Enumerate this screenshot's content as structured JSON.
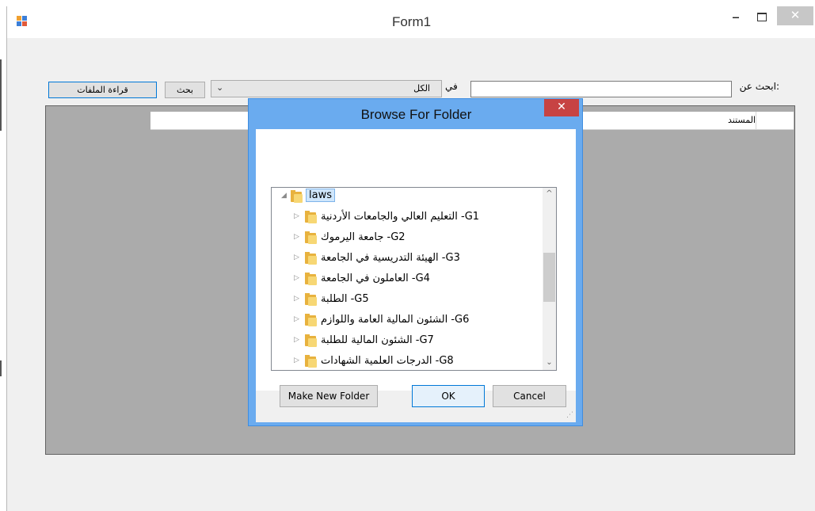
{
  "form": {
    "title": "Form1",
    "minimize": "–",
    "close": "✕"
  },
  "search": {
    "label": "ابحث عن:",
    "value": "",
    "in_label": "في",
    "scope_value": "الكل",
    "scope_arrow": "⌄",
    "search_button": "بحث",
    "read_files_button": "قراءة الملفات"
  },
  "grid": {
    "header_document": "المستند"
  },
  "dialog": {
    "title": "Browse For Folder",
    "close": "✕",
    "root": {
      "label": "laws",
      "expander": "◢"
    },
    "items": [
      {
        "label": "التعليم العالي والجامعات الأردنية -G1",
        "expander": "▷"
      },
      {
        "label": "جامعة اليرموك -G2",
        "expander": "▷"
      },
      {
        "label": "الهيئة التدريسية في الجامعة -G3",
        "expander": "▷"
      },
      {
        "label": "العاملون في الجامعة -G4",
        "expander": "▷"
      },
      {
        "label": "الطلبة -G5",
        "expander": "▷"
      },
      {
        "label": "الشئون المالية العامة واللوازم -G6",
        "expander": "▷"
      },
      {
        "label": "الشئون المالية للطلبة -G7",
        "expander": "▷"
      },
      {
        "label": "الدرجات العلمية الشهادات -G8",
        "expander": "▷"
      }
    ],
    "scroll_up": "^",
    "scroll_down": "⌄",
    "make_new_folder": "Make New Folder",
    "ok": "OK",
    "cancel": "Cancel",
    "grip": "⋰"
  },
  "colors": {
    "dialog_frame": "#6aabef",
    "dialog_close": "#c74343",
    "folder": "#e8b23e",
    "selection": "#cfe6fb"
  }
}
